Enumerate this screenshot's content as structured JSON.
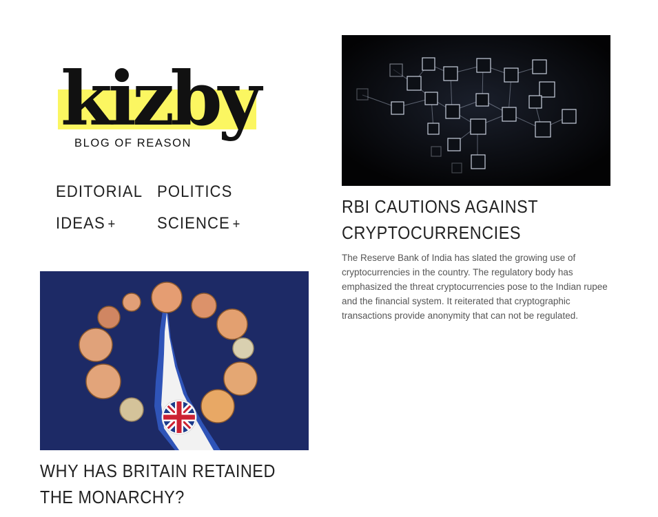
{
  "brand": {
    "name": "kizby",
    "tagline": "BLOG OF REASON",
    "highlight_color": "#fbf661"
  },
  "nav": {
    "items": [
      {
        "label": "EDITORIAL",
        "has_submenu": false
      },
      {
        "label": "POLITICS",
        "has_submenu": false
      },
      {
        "label": "IDEAS",
        "has_submenu": true,
        "submenu_marker": "+"
      },
      {
        "label": "SCIENCE",
        "has_submenu": true,
        "submenu_marker": "+"
      }
    ]
  },
  "posts": [
    {
      "title": "RBI CAUTIONS AGAINST CRYPTOCURRENCIES",
      "excerpt": "The Reserve Bank of India has slated the growing use of cryptocurrencies in the country. The regulatory body has emphasized the threat cryptocurrencies pose to the Indian rupee and the financial system. It reiterated that cryptographic transactions provide anonymity that can not be regulated.",
      "image": "blockchain-network-image"
    },
    {
      "title": "WHY HAS BRITAIN RETAINED THE MONARCHY?",
      "image": "coins-union-jack-image"
    }
  ]
}
